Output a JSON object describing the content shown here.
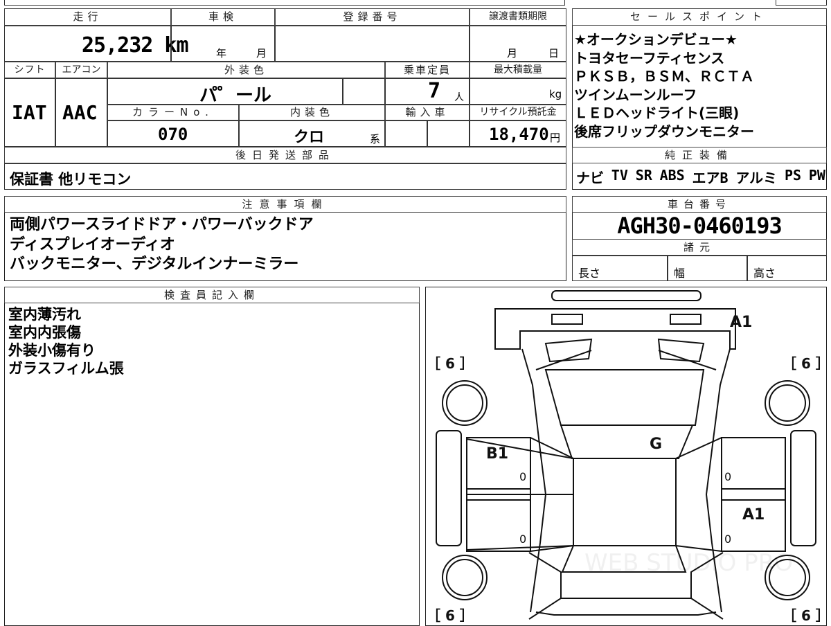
{
  "top": {
    "headers": {
      "mileage": "走行",
      "inspection": "車検",
      "registration": "登録番号",
      "transfer_deadline": "譲渡書類期限",
      "shift": "シフト",
      "aircon": "エアコン",
      "exterior_color": "外装色",
      "capacity": "乗車定員",
      "max_load": "最大積載量",
      "color_no": "カラーNo.",
      "interior_color": "内装色",
      "import": "輸入車",
      "recycle_fee": "リサイクル預託金",
      "later_parts": "後日発送部品"
    },
    "mileage_value": "25,232 km",
    "inspection_year": "年",
    "inspection_month": "月",
    "deadline_month": "月",
    "deadline_day": "日",
    "shift_value": "IAT",
    "aircon_value": "AAC",
    "exterior_value": "パ゜ール",
    "capacity_value": "7",
    "capacity_unit": "人",
    "max_load_unit": "kg",
    "color_no_value": "070",
    "interior_value": "クロ",
    "interior_suffix": "系",
    "recycle_value": "18,470",
    "recycle_unit": "円",
    "later_parts_value": "保証書 他リモコン"
  },
  "sales": {
    "header": "セールスポイント",
    "lines": [
      "★オークションデビュー★",
      "トヨタセーフティセンス",
      "ＰＫＳＢ，ＢＳＭ、ＲＣＴＡ",
      "ツインムーンルーフ",
      "ＬＥＤヘッドライト(三眼)",
      "後席フリップダウンモニター"
    ],
    "equip_header": "純正装備",
    "equip_values": [
      "ナビ",
      "TV",
      "SR",
      "ABS",
      "エアB",
      "アルミ",
      "PS",
      "PW"
    ]
  },
  "notes": {
    "header": "注意事項欄",
    "lines": [
      "両側パワースライドドア・パワーバックドア",
      "ディスプレイオーディオ",
      "バックモニター、デジタルインナーミラー"
    ]
  },
  "chassis": {
    "header": "車台番号",
    "value": "AGH30-0460193",
    "spec_header": "諸元",
    "length": "長さ",
    "width": "幅",
    "height": "高さ"
  },
  "inspector": {
    "header": "検査員記入欄",
    "lines": [
      "室内薄汚れ",
      "室内内張傷",
      "外装小傷有り",
      "ガラスフィルム張"
    ]
  },
  "diagram": {
    "marks": {
      "a1_top": "A1",
      "b1": "B1",
      "g": "G",
      "a1_right": "A1"
    },
    "tires": [
      "［ 6 ］",
      "［ 6 ］",
      "［ 6 ］",
      "［ 6 ］"
    ],
    "zeros": [
      "0",
      "0",
      "0",
      "0"
    ],
    "watermark": "WEB STUDIO PRO"
  }
}
